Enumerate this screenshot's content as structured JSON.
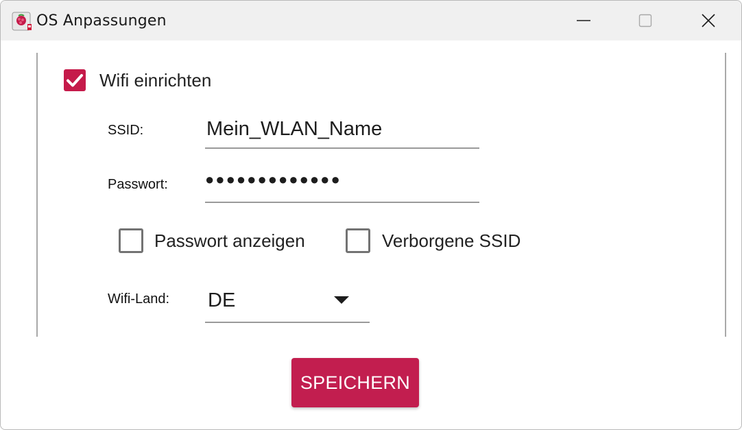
{
  "window": {
    "title": "OS Anpassungen",
    "controls": {
      "minimize_icon": "minimize-icon",
      "maximize_icon": "maximize-icon",
      "close_icon": "close-icon"
    }
  },
  "wifi": {
    "enable_label": "Wifi einrichten",
    "enabled": true,
    "ssid_label": "SSID:",
    "ssid_value": "Mein_WLAN_Name",
    "password_label": "Passwort:",
    "password_masked": "●●●●●●●●●●●●●",
    "show_password_label": "Passwort anzeigen",
    "show_password_checked": false,
    "hidden_ssid_label": "Verborgene SSID",
    "hidden_ssid_checked": false,
    "country_label": "Wifi-Land:",
    "country_value": "DE"
  },
  "actions": {
    "save_label": "SPEICHERN"
  },
  "colors": {
    "accent": "#c51a4a",
    "save_button": "#c21e4f",
    "titlebar": "#f0f0f0"
  }
}
